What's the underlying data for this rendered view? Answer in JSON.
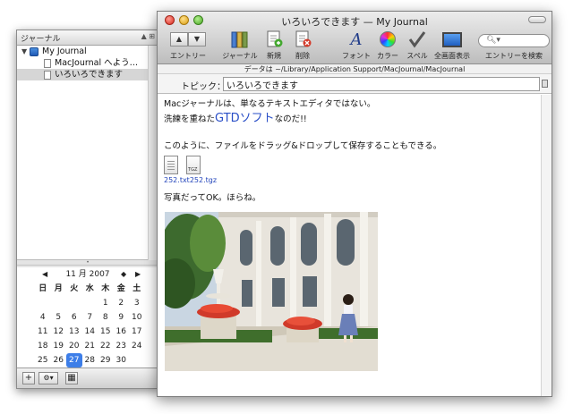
{
  "drawer": {
    "header": "ジャーナル",
    "tree": [
      {
        "label": "My Journal",
        "kind": "journal"
      },
      {
        "label": "MacJournal へよう…",
        "kind": "entry"
      },
      {
        "label": "いろいろできます",
        "kind": "entry",
        "selected": true
      }
    ],
    "calendar": {
      "month_label": "11 月 2007",
      "weekdays": [
        "日",
        "月",
        "火",
        "水",
        "木",
        "金",
        "土"
      ],
      "weeks": [
        [
          "",
          "",
          "",
          "",
          "1",
          "2",
          "3"
        ],
        [
          "4",
          "5",
          "6",
          "7",
          "8",
          "9",
          "10"
        ],
        [
          "11",
          "12",
          "13",
          "14",
          "15",
          "16",
          "17"
        ],
        [
          "18",
          "19",
          "20",
          "21",
          "22",
          "23",
          "24"
        ],
        [
          "25",
          "26",
          "27",
          "28",
          "29",
          "30",
          ""
        ]
      ],
      "today": "27"
    },
    "bottom": {
      "add": "+",
      "gear": "⚙▾"
    }
  },
  "window": {
    "title": "いろいろできます — My Journal",
    "toolbar": {
      "entry": "エントリー",
      "journal": "ジャーナル",
      "new": "新規",
      "delete": "削除",
      "font": "フォント",
      "color": "カラー",
      "spell": "スペル",
      "fullscreen": "全画面表示",
      "search": "エントリーを検索"
    },
    "path": "データは ~/Library/Application Support/MacJournal/MacJournal",
    "topic_label": "トピック：",
    "topic_value": "いろいろできます",
    "body": {
      "line1": "Macジャーナルは、単なるテキストエディタではない。",
      "line2_pre": "洗練を重ねた",
      "line2_link": "GTDソフト",
      "line2_post": "なのだ!!",
      "line3": "このように、ファイルをドラッグ&ドロップして保存することもできる。",
      "file1_label": "252.txt",
      "file2_label": "252.tgz",
      "file2_badge": "TGZ",
      "line4": "写真だってOK。ほらね。"
    }
  },
  "colors": {
    "accent": "#3d7ee8",
    "link": "#2a4fc7"
  }
}
